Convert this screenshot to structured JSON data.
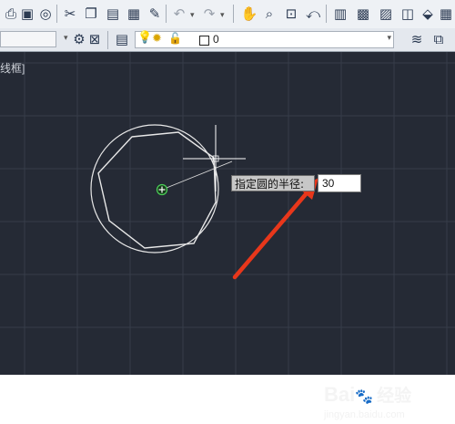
{
  "toolbar_top": {
    "icons": [
      "print-icon",
      "plot-preview-icon",
      "publish-icon",
      "cut-icon",
      "copy-icon",
      "paste-icon",
      "match-properties-icon",
      "block-editor-icon",
      "undo-icon",
      "redo-icon",
      "pan-icon",
      "zoom-realtime-icon",
      "zoom-window-icon",
      "zoom-previous-icon",
      "properties-icon",
      "design-center-icon",
      "tool-palettes-icon",
      "sheet-set-icon",
      "markup-icon",
      "quickcalc-icon"
    ]
  },
  "toolbar_layers": {
    "layer_value": "0",
    "icons": [
      "workspace-settings-icon",
      "lock-icon",
      "layer-manager-icon",
      "lightbulb-icon",
      "sun-icon",
      "unlock-icon",
      "layer-color-icon",
      "layer-previous-icon",
      "layer-states-icon"
    ]
  },
  "canvas": {
    "viewport_label": "线框]",
    "prompt_label": "指定圆的半径:",
    "radius_value": "30"
  },
  "watermark": {
    "logo_text": "Bai",
    "logo_suffix": "经验",
    "site": "jingyan.baidu.com"
  },
  "colors": {
    "canvas_bg": "#252a35",
    "grid": "#363c49",
    "geometry": "#e8e8e8",
    "arrow": "#e8371b",
    "center_marker": "#4cd058"
  }
}
